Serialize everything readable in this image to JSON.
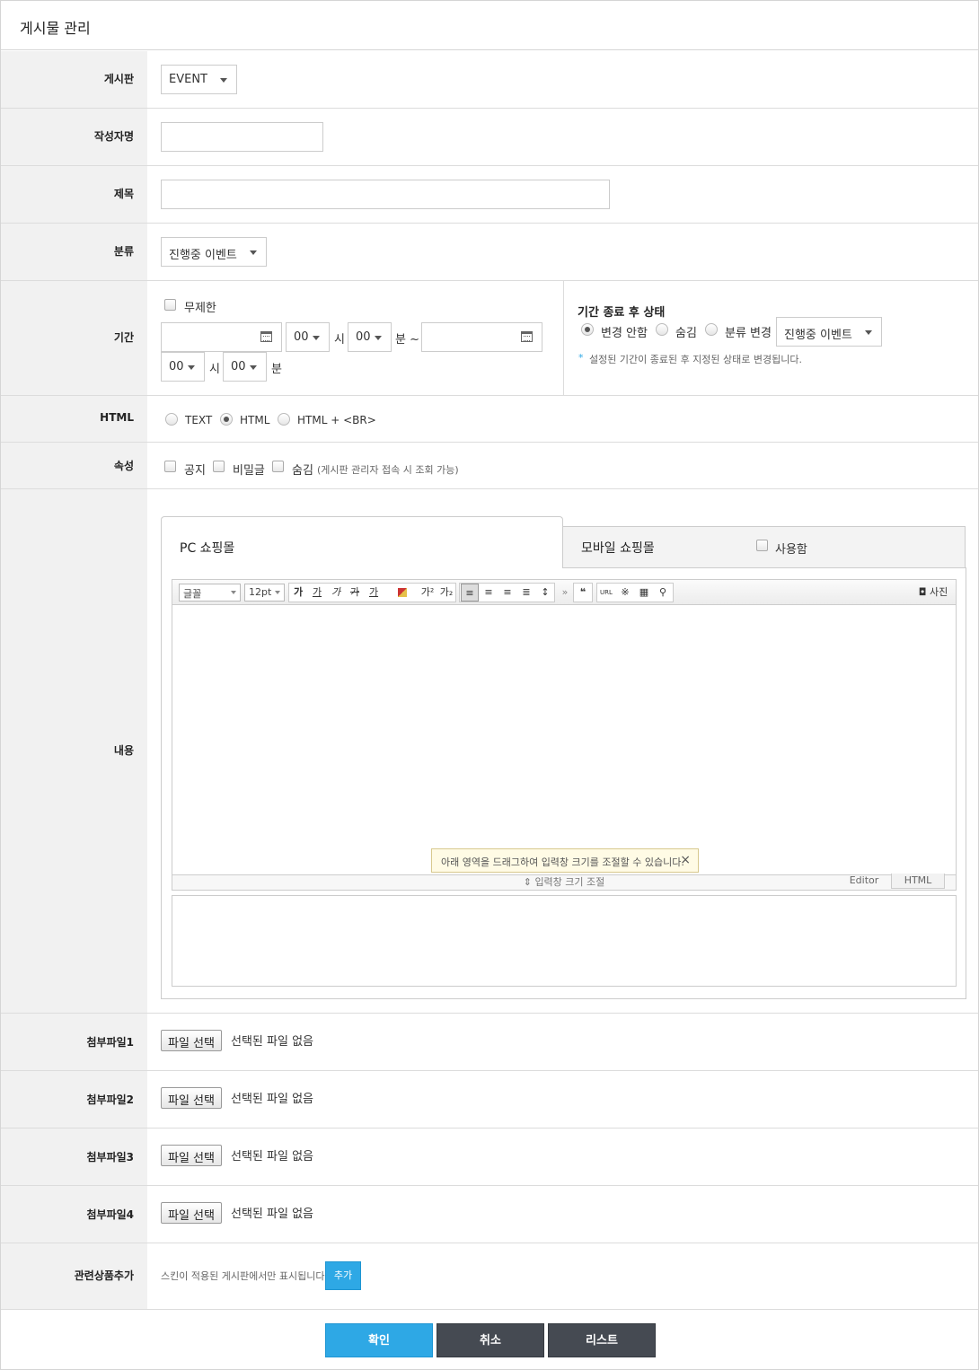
{
  "page": {
    "title": "게시물 관리"
  },
  "fields": {
    "board": {
      "label": "게시판",
      "value": "EVENT"
    },
    "author": {
      "label": "작성자명",
      "value": ""
    },
    "subject": {
      "label": "제목",
      "value": ""
    },
    "category": {
      "label": "분류",
      "value": "진행중 이벤트"
    },
    "period": {
      "label": "기간",
      "unlimited_label": "무제한",
      "start_hour": "00",
      "hour_unit": "시",
      "start_min": "00",
      "min_unit_tilde": "분 ~",
      "end_hour": "00",
      "end_min": "00",
      "min_unit": "분",
      "after_title": "기간 종료 후 상태",
      "after_options": [
        "변경 안함",
        "숨김",
        "분류 변경"
      ],
      "after_selected": "변경 안함",
      "after_category": "진행중 이벤트",
      "note_bullet": "*",
      "note": "설정된 기간이 종료된 후 지정된 상태로 변경됩니다."
    },
    "html": {
      "label": "HTML",
      "options": [
        "TEXT",
        "HTML",
        "HTML + <BR>"
      ],
      "selected": "HTML"
    },
    "attributes": {
      "label": "속성",
      "notice": "공지",
      "secret": "비밀글",
      "hidden": "숨김",
      "hidden_note": "(게시판 관리자 접속 시 조회 가능)"
    },
    "content": {
      "label": "내용",
      "tab_pc": "PC 쇼핑몰",
      "tab_mobile": "모바일 쇼핑몰",
      "mobile_use": "사용함",
      "toolbar": {
        "font": "글꼴",
        "size": "12pt",
        "bold": "가",
        "underline": "가",
        "italic": "가",
        "strike": "가",
        "fontcolor": "가",
        "sup": "가²",
        "sub": "가₂",
        "quote": "❝",
        "url": "URL",
        "special": "※",
        "photo": "사진"
      },
      "tooltip": "아래 영역을 드래그하여 입력창 크기를 조절할 수 있습니다.",
      "resize_label": "입력창 크기 조절",
      "mode_editor": "Editor",
      "mode_html": "HTML"
    },
    "attachments": [
      {
        "label": "첨부파일1",
        "button": "파일 선택",
        "status": "선택된 파일 없음"
      },
      {
        "label": "첨부파일2",
        "button": "파일 선택",
        "status": "선택된 파일 없음"
      },
      {
        "label": "첨부파일3",
        "button": "파일 선택",
        "status": "선택된 파일 없음"
      },
      {
        "label": "첨부파일4",
        "button": "파일 선택",
        "status": "선택된 파일 없음"
      }
    ],
    "related": {
      "label": "관련상품추가",
      "note": "스킨이 적용된 게시판에서만 표시됩니다.",
      "button": "추가"
    }
  },
  "actions": {
    "confirm": "확인",
    "cancel": "취소",
    "list": "리스트"
  },
  "colors": {
    "primary": "#2ea8e5",
    "dark": "#454a52",
    "label_bg": "#f1f1f1"
  }
}
